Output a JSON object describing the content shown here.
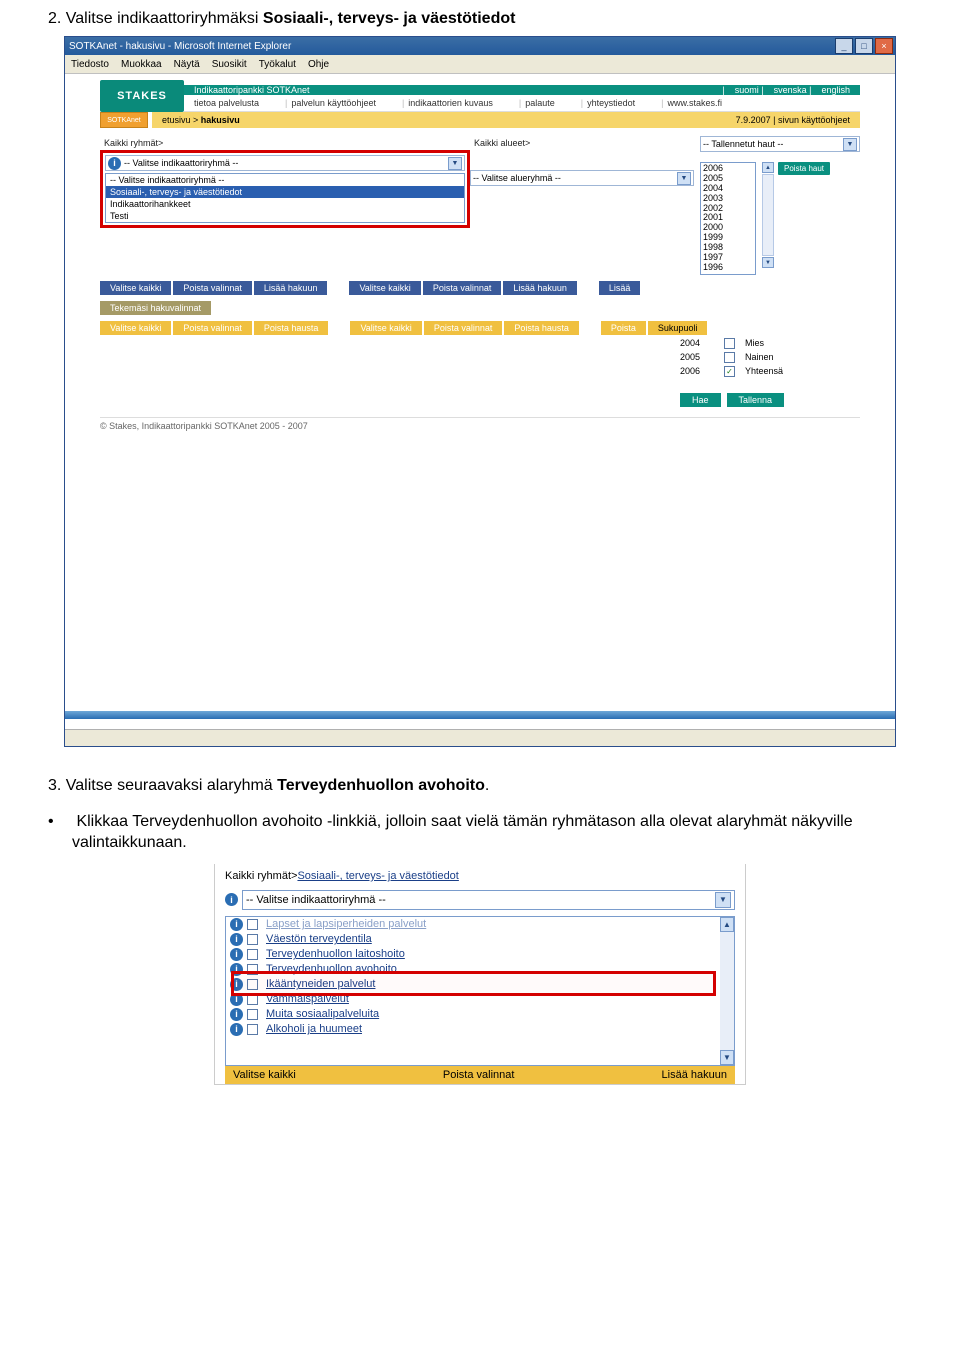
{
  "step2": {
    "prefix": "2. Valitse indikaattoriryhmäksi ",
    "bold": "Sosiaali-, terveys- ja väestötiedot"
  },
  "step3": {
    "prefix": "3. Valitse seuraavaksi alaryhmä ",
    "bold": "Terveydenhuollon avohoito",
    "suffix": "."
  },
  "bullet": {
    "part1": "Klikkaa Terveydenhuollon avohoito -",
    "bold": "linkkiä",
    "part2": ", jolloin saat vielä tämän ryhmätason alla olevat alaryhmät näkyville valintaikkunaan."
  },
  "ie": {
    "title": "SOTKAnet - hakusivu - Microsoft Internet Explorer",
    "menu": [
      "Tiedosto",
      "Muokkaa",
      "Näytä",
      "Suosikit",
      "Työkalut",
      "Ohje"
    ],
    "win_min": "_",
    "win_max": "□",
    "win_close": "×"
  },
  "banner": {
    "stakes": "STAKES",
    "sotka": "SOTKAnet",
    "title": "Indikaattoripankki SOTKAnet",
    "langs": [
      "suomi",
      "svenska",
      "english"
    ],
    "nav_left": [
      "tietoa palvelusta",
      "palvelun käyttöohjeet",
      "indikaattorien kuvaus",
      "palaute",
      "yhteystiedot",
      "www.stakes.fi"
    ],
    "crumb_pre": "etusivu > ",
    "crumb_cur": "hakusivu",
    "date": "7.9.2007",
    "page_help": "sivun käyttöohjeet"
  },
  "first": {
    "all_groups": "Kaikki ryhmät>",
    "all_areas": "Kaikki alueet>",
    "saved_searches": "-- Tallennetut haut --",
    "sel_group": "-- Valitse indikaattoriryhmä --",
    "dropdown": [
      "-- Valitse indikaattoriryhmä --",
      "Sosiaali-, terveys- ja väestötiedot",
      "Indikaattorihankkeet",
      "Testi"
    ],
    "sel_region": "-- Valitse alueryhmä --",
    "years": [
      "2006",
      "2005",
      "2004",
      "2003",
      "2002",
      "2001",
      "2000",
      "1999",
      "1998",
      "1997",
      "1996"
    ],
    "poista_haut": "Poista haut",
    "row_blue": {
      "l": [
        "Valitse kaikki",
        "Poista valinnat",
        "Lisää hakuun"
      ],
      "m": [
        "Valitse kaikki",
        "Poista valinnat",
        "Lisää hakuun"
      ],
      "r": "Lisää"
    },
    "row_olive": "Tekemäsi hakuvalinnat",
    "row_yellow": {
      "l": [
        "Valitse kaikki",
        "Poista valinnat",
        "Poista hausta"
      ],
      "m": [
        "Valitse kaikki",
        "Poista valinnat",
        "Poista hausta"
      ],
      "r": "Poista",
      "sex": "Sukupuoli"
    },
    "picked_years": [
      "2004",
      "2005",
      "2006"
    ],
    "sex": {
      "mies": "Mies",
      "nainen": "Nainen",
      "yht": "Yhteensä"
    },
    "hae": "Hae",
    "tallenna": "Tallenna",
    "copyright": "© Stakes, Indikaattoripankki SOTKAnet 2005 - 2007"
  },
  "second": {
    "crumb_pre": "Kaikki ryhmät>",
    "crumb_link": "Sosiaali-, terveys- ja väestötiedot",
    "sel": "-- Valitse indikaattoriryhmä --",
    "items": [
      "Lapset ja lapsiperheiden palvelut",
      "Väestön terveydentila",
      "Terveydenhuollon laitoshoito",
      "Terveydenhuollon avohoito",
      "Ikääntyneiden palvelut",
      "Vammaispalvelut",
      "Muita sosiaalipalveluita",
      "Alkoholi ja huumeet"
    ],
    "bottom": [
      "Valitse kaikki",
      "Poista valinnat",
      "Lisää hakuun"
    ]
  }
}
